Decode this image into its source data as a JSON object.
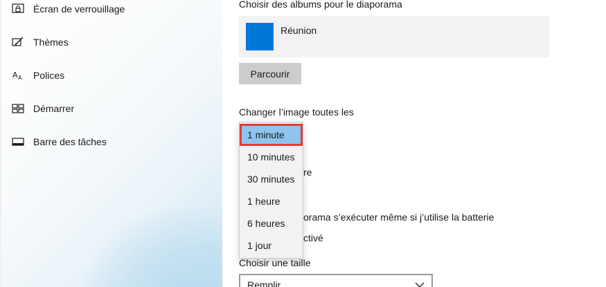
{
  "sidebar": {
    "items": [
      {
        "label": "Écran de verrouillage",
        "icon": "lock-screen-icon"
      },
      {
        "label": "Thèmes",
        "icon": "themes-icon"
      },
      {
        "label": "Polices",
        "icon": "fonts-icon"
      },
      {
        "label": "Démarrer",
        "icon": "start-icon"
      },
      {
        "label": "Barre des tâches",
        "icon": "taskbar-icon"
      }
    ]
  },
  "main": {
    "albums_title": "Choisir des albums pour le diaporama",
    "album_name": "Réunion",
    "browse_label": "Parcourir",
    "change_label": "Changer l’image toutes les",
    "partial_1": "re",
    "partial_2": "orama s’exécuter même si j’utilise la batterie",
    "partial_3": "ctivé",
    "size_label": "Choisir une taille",
    "size_value": "Remplir"
  },
  "dropdown": {
    "options": [
      "1 minute",
      "10 minutes",
      "30 minutes",
      "1 heure",
      "6 heures",
      "1 jour"
    ],
    "selected": "1 minute"
  },
  "colors": {
    "accent": "#0078d7",
    "selected_bg": "#8ec5f0",
    "highlight_border": "#e03c3c"
  }
}
